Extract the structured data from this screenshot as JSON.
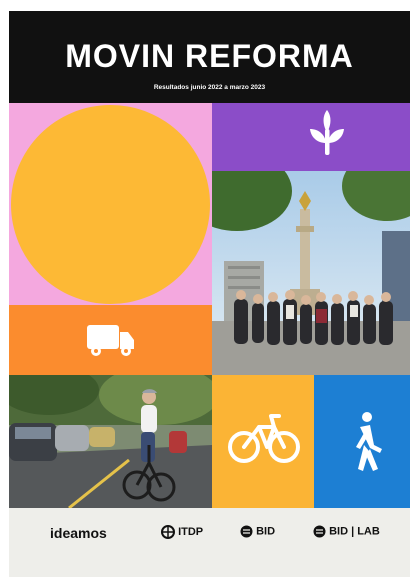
{
  "cover": {
    "title": "MOVIN REFORMA",
    "subtitle": "Resultados junio 2022 a marzo 2023"
  },
  "colors": {
    "header": "#111111",
    "pink": "#f4a8df",
    "yellow": "#fdb935",
    "orange": "#fb8c2e",
    "purple": "#8b4dc8",
    "blue": "#1d7fd3",
    "footer": "#eeeeea"
  },
  "icons": {
    "purple_block": "sprout-icon",
    "orange_block": "delivery-truck-icon",
    "yellow_block": "bicycle-icon",
    "blue_block": "pedestrian-walking-icon"
  },
  "photos": {
    "group": "group-photo-angel-monument",
    "cyclist": "cyclist-on-bike-lane-photo"
  },
  "logos": {
    "ideamos": "ideamos",
    "itdp": "ITDP",
    "bid": "BID",
    "bid_lab": "BID | LAB"
  }
}
